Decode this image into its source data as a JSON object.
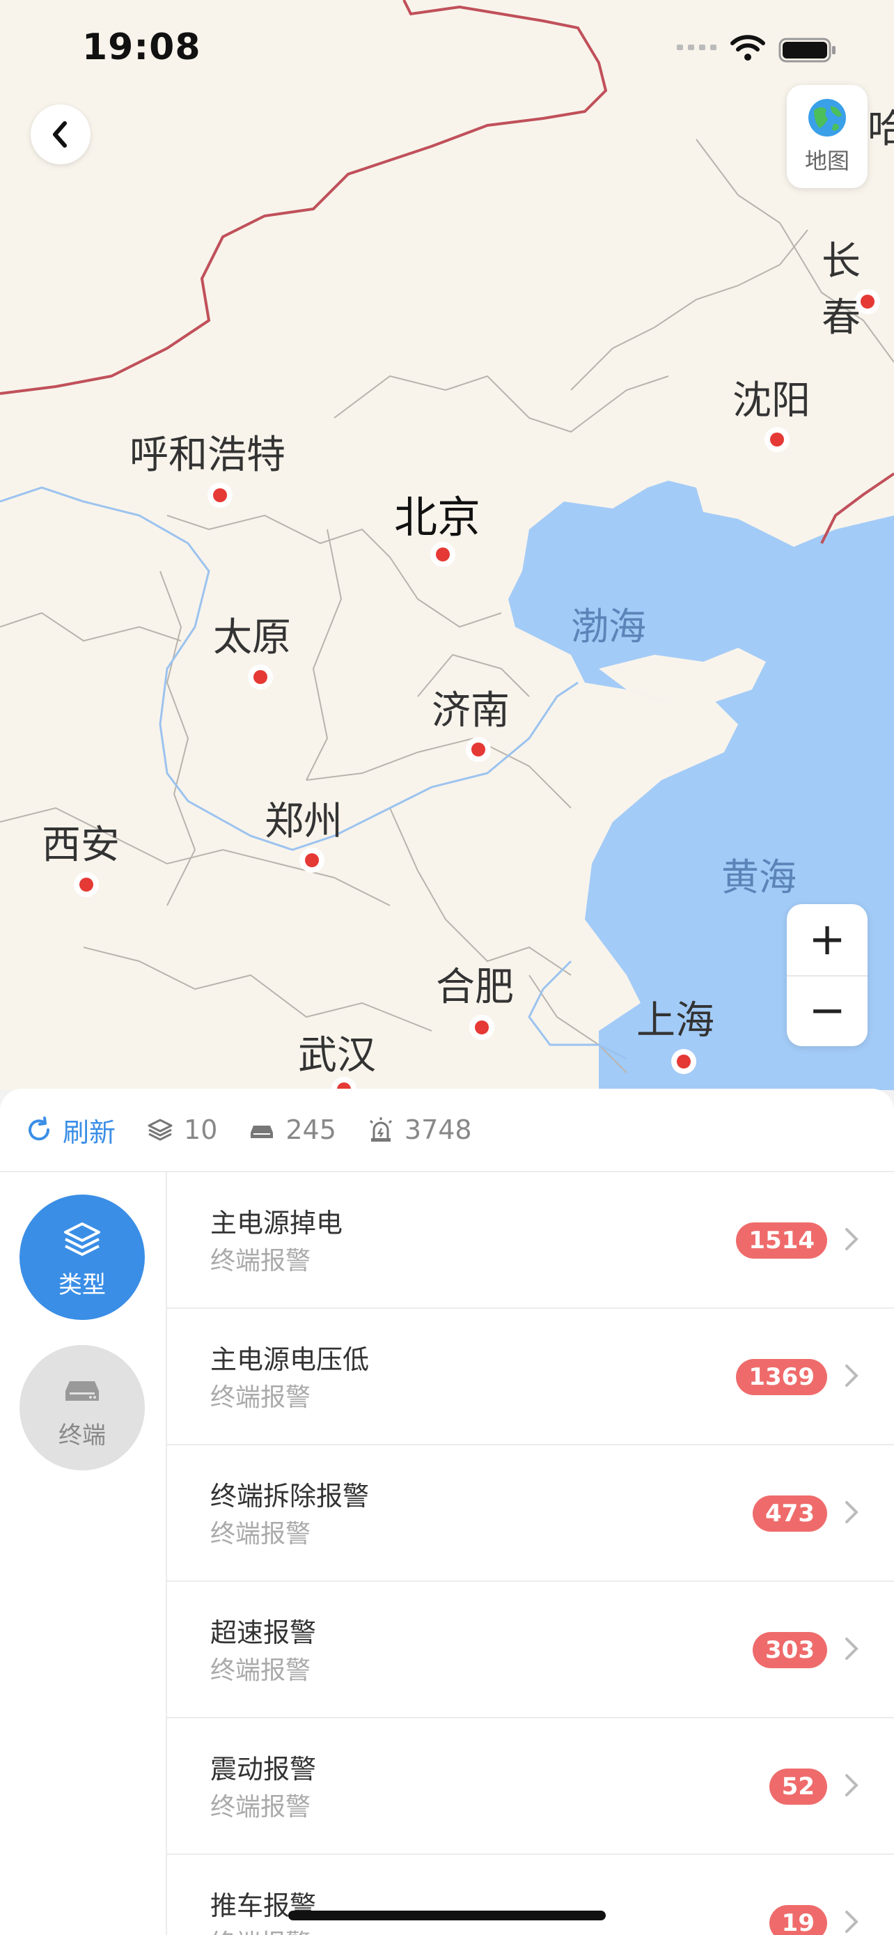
{
  "status": {
    "time": "19:08"
  },
  "map": {
    "layer_button_label": "地图",
    "zoom_in": "+",
    "zoom_out": "−",
    "cities": {
      "harbin_partial": "哈",
      "changchun": "长春",
      "shenyang": "沈阳",
      "hohhot": "呼和浩特",
      "beijing": "北京",
      "taiyuan": "太原",
      "jinan": "济南",
      "zhengzhou": "郑州",
      "xian": "西安",
      "hefei": "合肥",
      "wuhan": "武汉",
      "shanghai": "上海"
    },
    "seas": {
      "bohai": "渤海",
      "huanghai": "黄海"
    }
  },
  "toolbar": {
    "refresh_label": "刷新",
    "layers_count": "10",
    "terminals_count": "245",
    "alarms_count": "3748"
  },
  "sidebar": {
    "type_label": "类型",
    "terminal_label": "终端"
  },
  "alarms": [
    {
      "title": "主电源掉电",
      "subtitle": "终端报警",
      "count": "1514"
    },
    {
      "title": "主电源电压低",
      "subtitle": "终端报警",
      "count": "1369"
    },
    {
      "title": "终端拆除报警",
      "subtitle": "终端报警",
      "count": "473"
    },
    {
      "title": "超速报警",
      "subtitle": "终端报警",
      "count": "303"
    },
    {
      "title": "震动报警",
      "subtitle": "终端报警",
      "count": "52"
    },
    {
      "title": "推车报警",
      "subtitle": "终端报警",
      "count": "19"
    }
  ],
  "colors": {
    "accent": "#3a8ee6",
    "badge": "#ef6b6b",
    "sea": "#a3cbf7",
    "border": "#c0505a"
  }
}
